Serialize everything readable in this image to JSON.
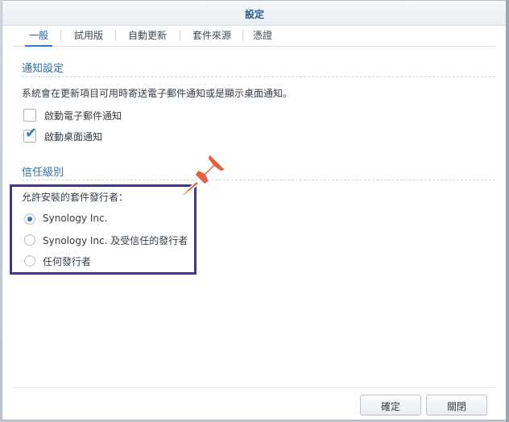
{
  "dialog": {
    "title": "設定"
  },
  "tabs": [
    {
      "label": "一般",
      "active": true
    },
    {
      "label": "試用版"
    },
    {
      "label": "自動更新"
    },
    {
      "label": "套件來源"
    },
    {
      "label": "憑證"
    }
  ],
  "notify": {
    "title": "通知設定",
    "description": "系統會在更新項目可用時寄送電子郵件通知或是顯示桌面通知。",
    "email_label": "啟動電子郵件通知",
    "email_checked": false,
    "desktop_label": "啟動桌面通知",
    "desktop_checked": true
  },
  "trust": {
    "title": "信任級別",
    "prompt": "允許安裝的套件發行者：",
    "options": [
      {
        "label": "Synology Inc.",
        "selected": true
      },
      {
        "label": "Synology Inc. 及受信任的發行者",
        "selected": false
      },
      {
        "label": "任何發行者",
        "selected": false
      }
    ]
  },
  "buttons": {
    "ok": "確定",
    "close": "關閉"
  },
  "colors": {
    "accent": "#2d78c1",
    "highlight": "#3b3a8f",
    "pin": "#e0623f"
  },
  "icons": {
    "pin": "pushpin-icon",
    "check": "check-icon"
  }
}
